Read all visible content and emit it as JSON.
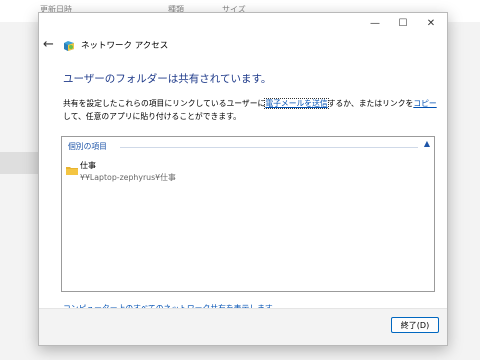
{
  "background": {
    "columns": [
      "更新日時",
      "種類",
      "サイズ"
    ]
  },
  "window": {
    "min_glyph": "—",
    "max_glyph": "☐",
    "close_glyph": "✕"
  },
  "nav": {
    "back_glyph": "←",
    "title": "ネットワーク アクセス"
  },
  "heading": "ユーザーのフォルダーは共有されています。",
  "description": {
    "part1": "共有を設定したこれらの項目にリンクしているユーザーに",
    "link_email": "電子メールを送信",
    "part2": "するか、またはリンクを",
    "link_copy": "コピー",
    "part3": "して、任意のアプリに貼り付けることができます。"
  },
  "list": {
    "group_label": "個別の項目",
    "chevron": "▲",
    "items": [
      {
        "name": "仕事",
        "path": "¥¥Laptop-zephyrus¥仕事",
        "icon": "folder-icon"
      }
    ]
  },
  "bottom_link": "コンピューター上のすべてのネットワーク共有を表示します。",
  "footer": {
    "done_label": "終了(D)"
  },
  "colors": {
    "heading": "#1e3a8a",
    "link": "#0050b3",
    "accent": "#0067c0",
    "folder": "#f4c542"
  }
}
